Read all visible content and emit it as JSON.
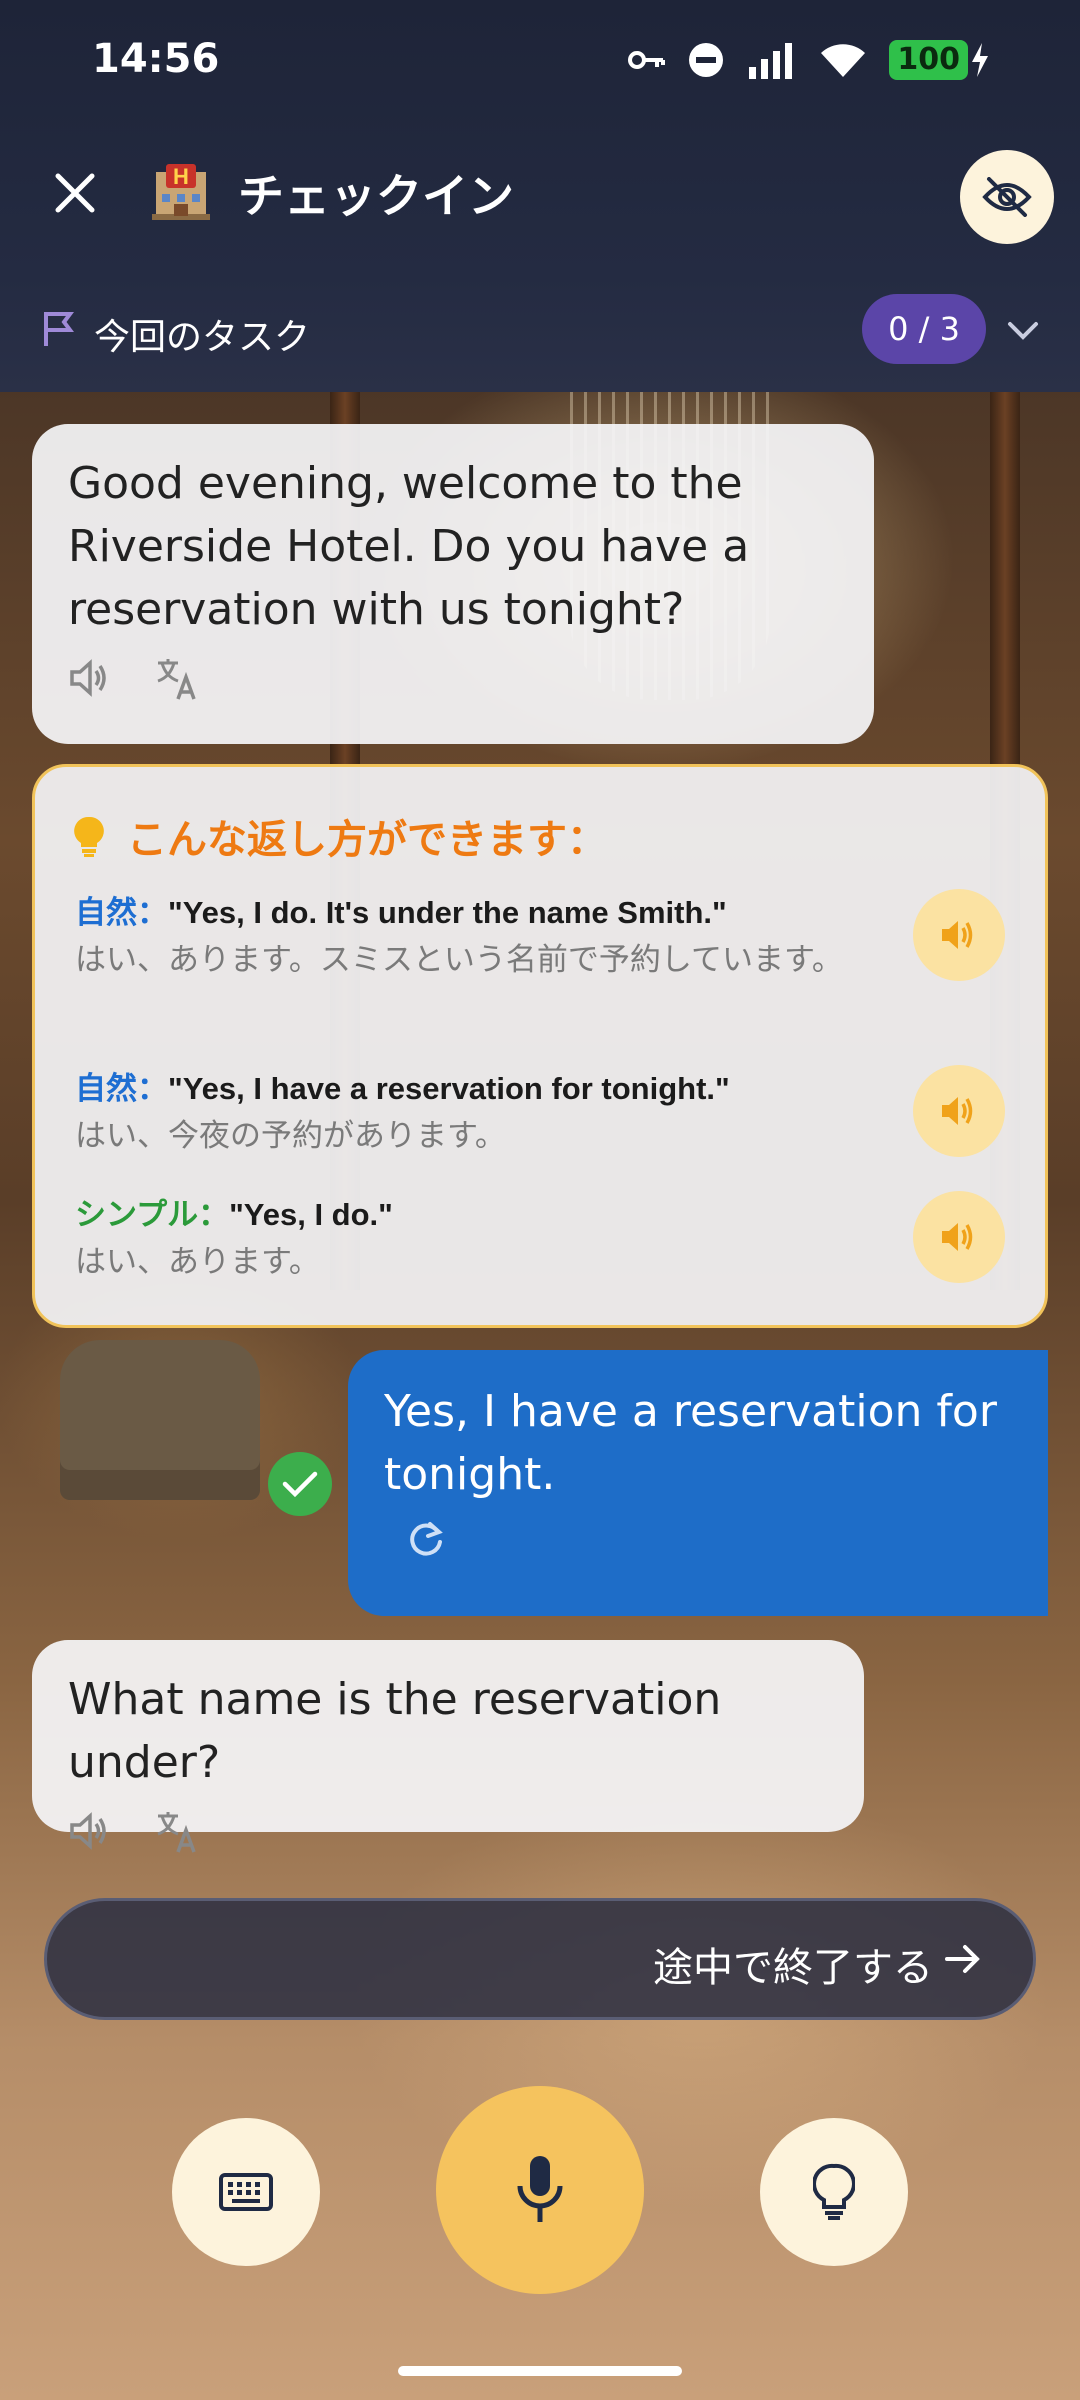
{
  "status_bar": {
    "time": "14:56",
    "battery": "100"
  },
  "header": {
    "title": "チェックイン"
  },
  "task": {
    "label": "今回のタスク",
    "progress": "0 / 3"
  },
  "messages": {
    "ai_1": "Good evening, welcome to the Riverside Hotel. Do you have a reservation with us tonight?",
    "user_1": "Yes, I have a reservation for tonight.",
    "ai_2": "What name is the reservation under?"
  },
  "hints": {
    "title": "こんな返し方ができます：",
    "items": [
      {
        "tag": "自然：",
        "en": "\"Yes, I do. It's under the name Smith.\"",
        "ja": "はい、あります。スミスという名前で予約しています。"
      },
      {
        "tag": "自然：",
        "en": "\"Yes, I have a reservation for tonight.\"",
        "ja": "はい、今夜の予約があります。"
      },
      {
        "tag": "シンプル：",
        "en": "\"Yes, I do.\"",
        "ja": "はい、あります。"
      }
    ]
  },
  "end_button": {
    "label": "途中で終了する"
  },
  "colors": {
    "accent": "#f5c35e",
    "user_bubble": "#1e6dc8",
    "hint_title": "#ee7a12",
    "task_badge": "#5b45a8"
  },
  "icons": [
    "close-icon",
    "hotel-icon",
    "eye-off-icon",
    "flag-icon",
    "chevron-down-icon",
    "speaker-icon",
    "translate-icon",
    "lightbulb-icon",
    "check-icon",
    "refresh-icon",
    "arrow-right-icon",
    "keyboard-icon",
    "microphone-icon"
  ]
}
